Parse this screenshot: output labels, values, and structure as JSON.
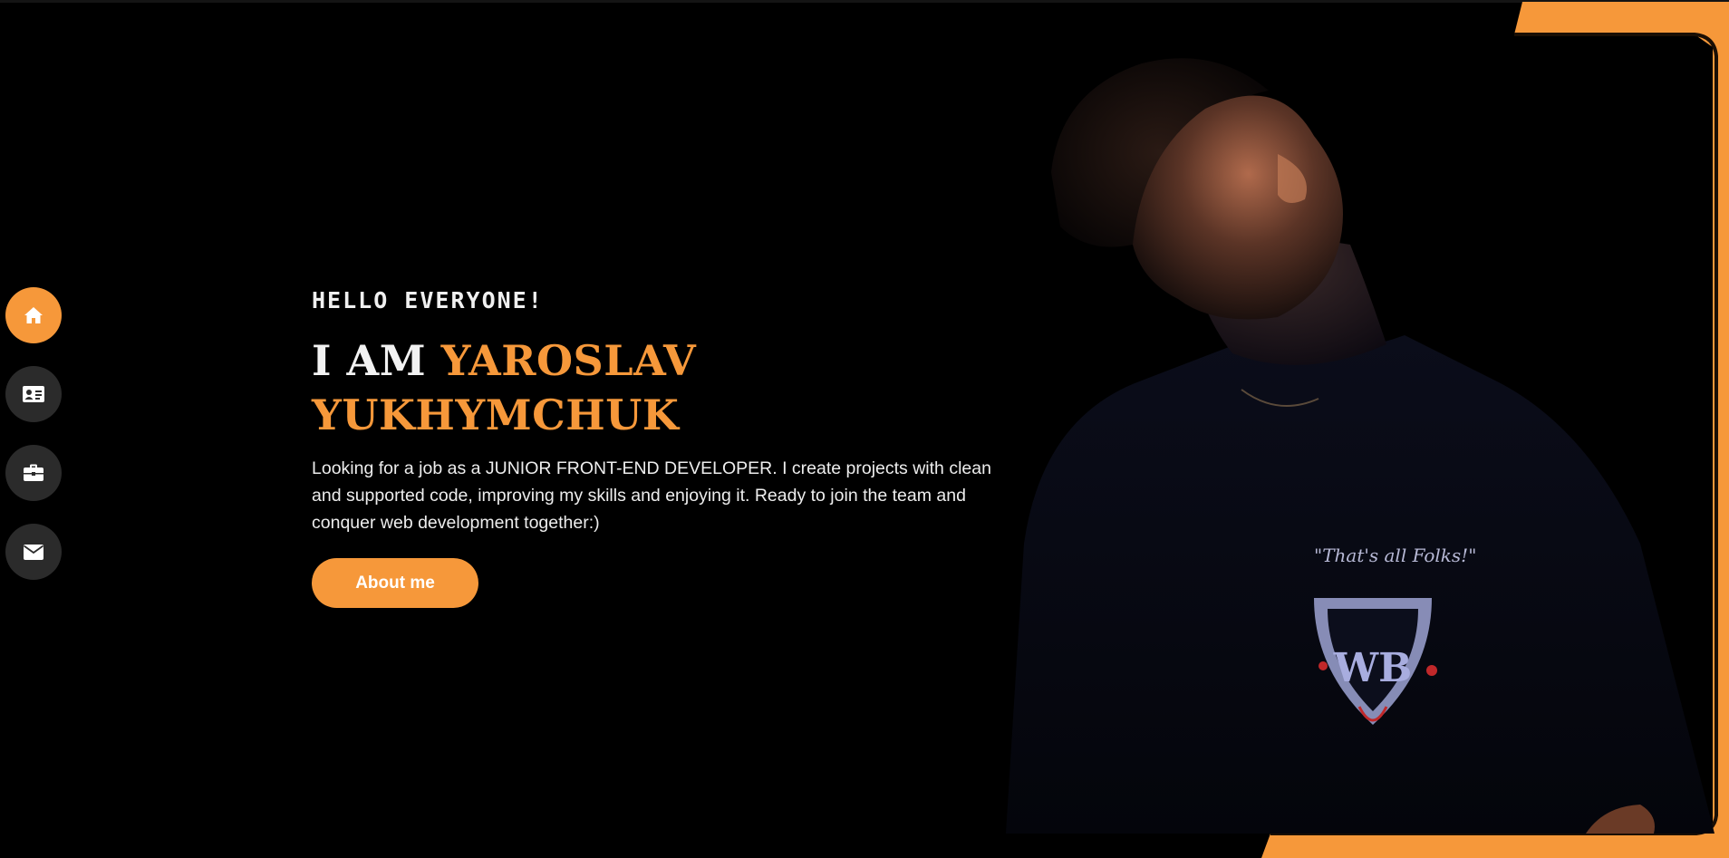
{
  "nav": {
    "items": [
      {
        "icon": "home-icon",
        "label": "Home",
        "active": true
      },
      {
        "icon": "id-card-icon",
        "label": "About",
        "active": false
      },
      {
        "icon": "briefcase-icon",
        "label": "Portfolio",
        "active": false
      },
      {
        "icon": "envelope-icon",
        "label": "Contact",
        "active": false
      }
    ]
  },
  "hero": {
    "greeting": "HELLO EVERYONE!",
    "title_prefix": "I AM ",
    "title_name": "YAROSLAV YUKHYMCHUK",
    "description": "Looking for a job as a JUNIOR FRONT-END DEVELOPER. I create projects with clean and supported code, improving my skills and enjoying it. Ready to join the team and conquer web development together:)",
    "cta_label": "About me"
  },
  "portrait": {
    "shirt_text": "\"That's all Folks!\"",
    "shirt_logo": "WB"
  },
  "colors": {
    "accent": "#f6983a",
    "background": "#000000",
    "nav_inactive": "#2b2b2b"
  }
}
